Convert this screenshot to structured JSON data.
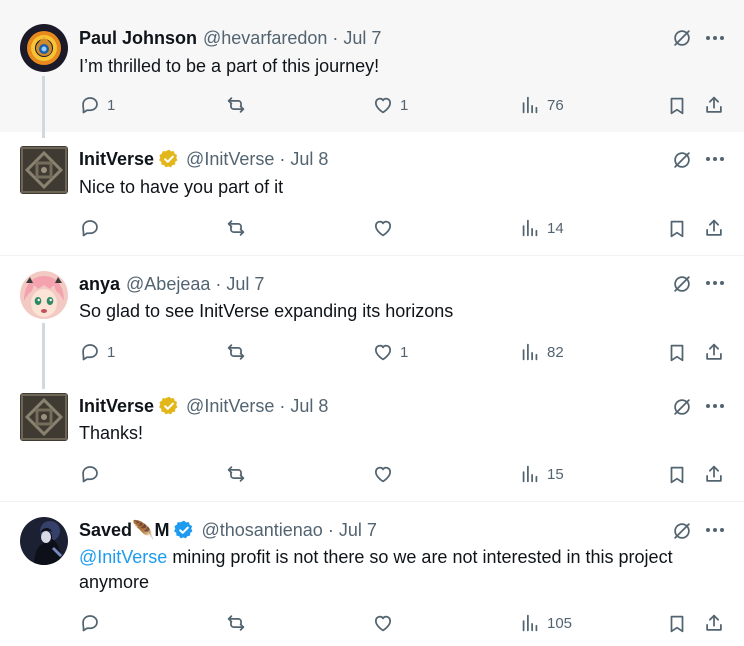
{
  "tweets": [
    {
      "name": "Paul Johnson",
      "handle": "@hevarfaredon",
      "separator": "·",
      "date": "Jul 7",
      "text": "I’m thrilled to be a part of this journey!",
      "replies": "1",
      "retweets": "",
      "likes": "1",
      "views": "76",
      "verified": "none",
      "avatar": "flame-ring-avatar"
    },
    {
      "name": "InitVerse",
      "handle": "@InitVerse",
      "separator": "·",
      "date": "Jul 8",
      "text": "Nice to have you part of it",
      "replies": "",
      "retweets": "",
      "likes": "",
      "views": "14",
      "verified": "gold",
      "avatar": "stone-knot-avatar"
    },
    {
      "name": "anya",
      "handle": "@Abejeaa",
      "separator": "·",
      "date": "Jul 7",
      "text": "So glad to see InitVerse expanding its horizons",
      "replies": "1",
      "retweets": "",
      "likes": "1",
      "views": "82",
      "verified": "none",
      "avatar": "anime-girl-avatar"
    },
    {
      "name": "InitVerse",
      "handle": "@InitVerse",
      "separator": "·",
      "date": "Jul 8",
      "text": "Thanks!",
      "replies": "",
      "retweets": "",
      "likes": "",
      "views": "15",
      "verified": "gold",
      "avatar": "stone-knot-avatar"
    },
    {
      "name": "Saved🪶M",
      "handle": "@thosantienao",
      "separator": "·",
      "date": "Jul 7",
      "mention": "@InitVerse",
      "text_line1": " mining profit is not there so we are not interested in this project",
      "text_line2": "anymore",
      "replies": "",
      "retweets": "",
      "likes": "",
      "views": "105",
      "verified": "blue",
      "avatar": "dark-character-avatar"
    }
  ],
  "colors": {
    "text_primary": "#0f1419",
    "text_secondary": "#536471",
    "link": "#1d9bf0",
    "verified_gold": "#e2b719",
    "verified_blue": "#1d9bf0",
    "highlight_bg": "#f7f7f7",
    "divider": "#eff3f4",
    "thread_line": "#cfd9de"
  },
  "icons": {
    "reply": "speech-bubble-icon",
    "retweet": "repost-arrows-icon",
    "like": "heart-icon",
    "views": "bar-chart-icon",
    "bookmark": "bookmark-icon",
    "share": "share-upload-icon",
    "grok": "grok-slash-circle-icon",
    "more": "more-dots-icon"
  }
}
